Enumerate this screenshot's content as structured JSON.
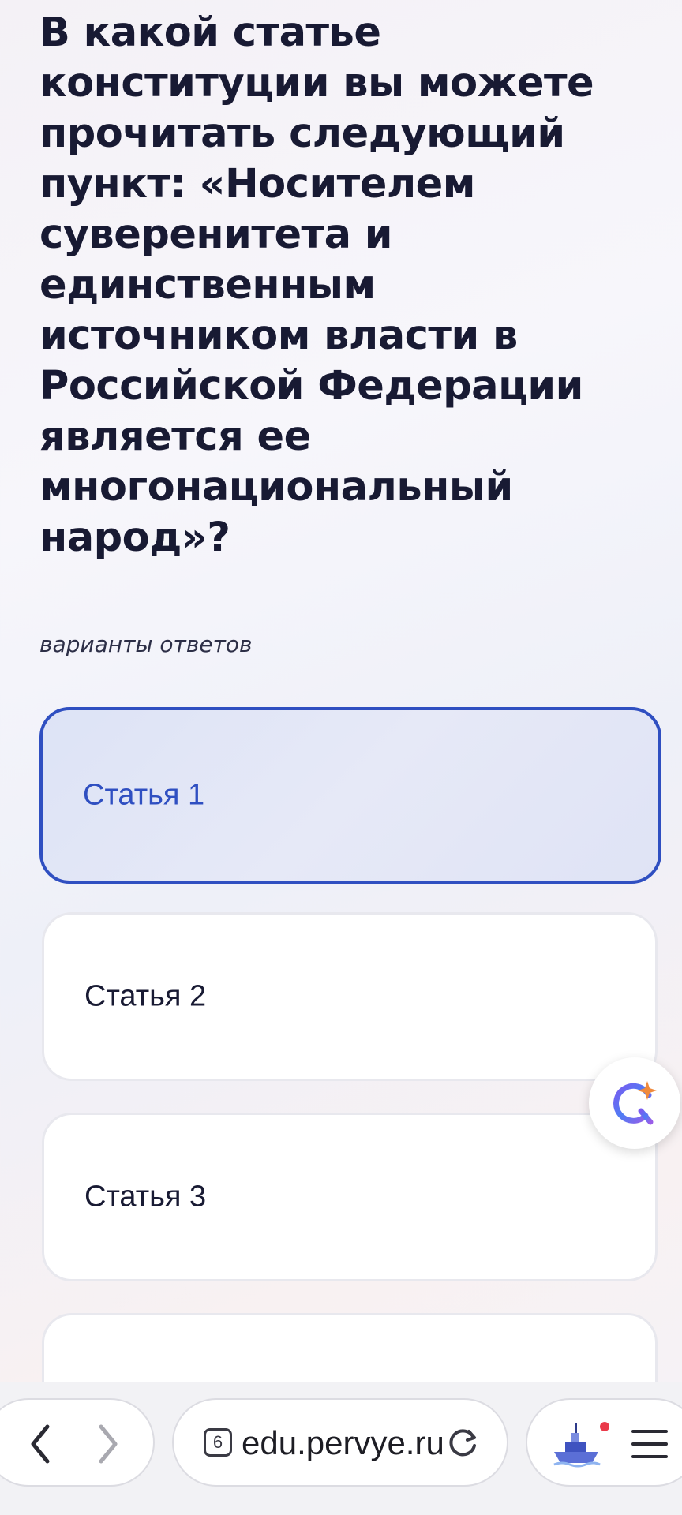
{
  "question": {
    "text": "В какой статье\nконституции вы можете\nпрочитать следующий\nпункт: «Носителем\nсуверенитета и\nединственным\nисточником власти в\nРоссийской Федерации\nявляется ее\nмногонациональный\nнарод»?"
  },
  "answers": {
    "label": "варианты ответов",
    "options": [
      {
        "label": "Статья 1",
        "selected": true
      },
      {
        "label": "Статья 2",
        "selected": false
      },
      {
        "label": "Статья 3",
        "selected": false
      },
      {
        "label": "",
        "selected": false
      }
    ]
  },
  "floating_button": {
    "icon": "ai-assistant-icon"
  },
  "browser": {
    "tab_count": "6",
    "url": "edu.pervye.ru",
    "icons": [
      "back-icon",
      "forward-icon",
      "tabs-icon",
      "reload-icon",
      "ship-icon",
      "menu-icon"
    ]
  },
  "colors": {
    "accent": "#2f4fc1",
    "selected_bg": "#e1e6f7",
    "text": "#181a33",
    "notification": "#ea3a4a"
  }
}
